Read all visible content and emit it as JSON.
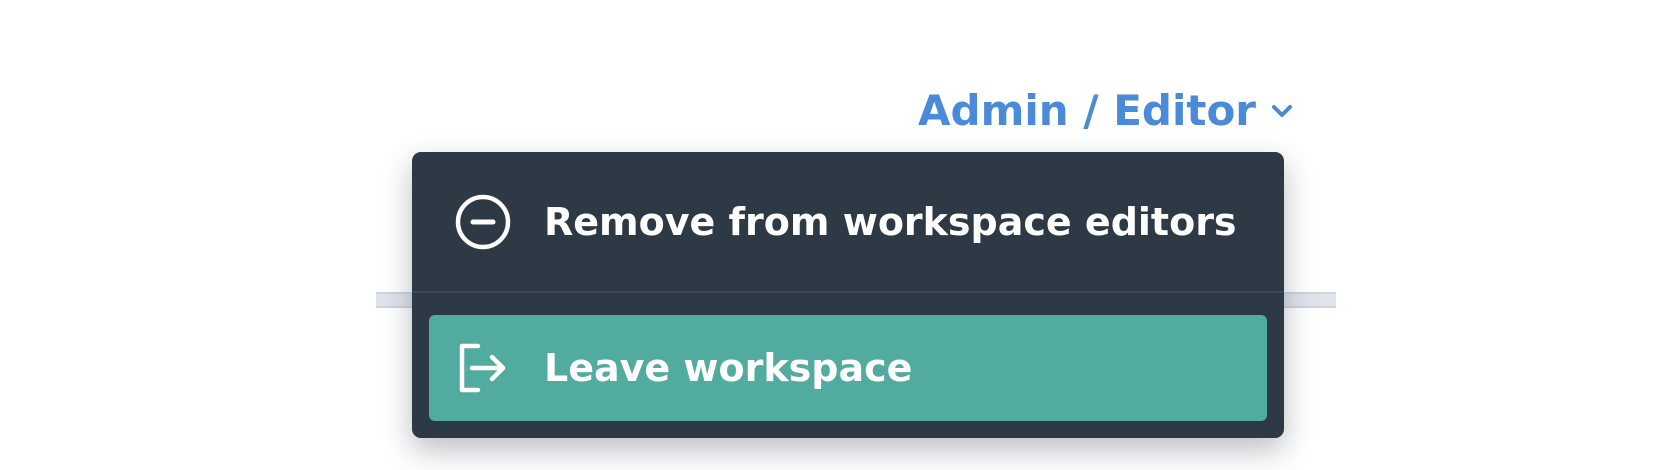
{
  "role_selector": {
    "label": "Admin / Editor",
    "icon": "chevron-down-icon",
    "color": "#4a8ad8"
  },
  "menu": {
    "background": "#2e3946",
    "items": [
      {
        "label": "Remove from workspace editors",
        "icon": "minus-circle-icon",
        "highlighted": false
      },
      {
        "label": "Leave workspace",
        "icon": "sign-out-icon",
        "highlighted": true,
        "highlight_color": "#52ab9f"
      }
    ]
  }
}
